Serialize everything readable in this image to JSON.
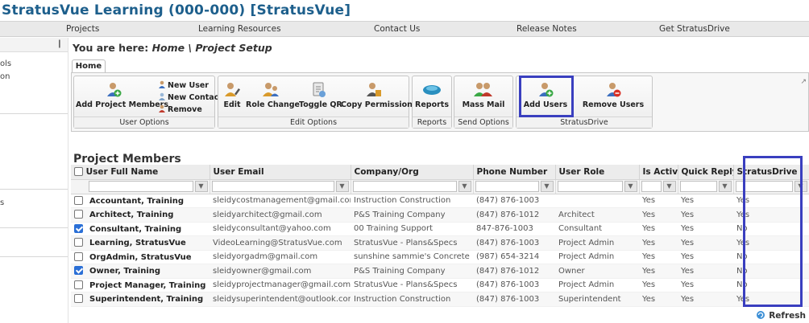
{
  "app": {
    "title": "StratusVue Learning (000-000) [StratusVue]"
  },
  "topnav": [
    "Projects",
    "Learning Resources",
    "Contact Us",
    "Release Notes",
    "Get StratusDrive"
  ],
  "leftpanel": {
    "items": [
      "ols",
      "on",
      "s"
    ]
  },
  "breadcrumb": {
    "prefix": "You are here:",
    "path": "Home \\ Project Setup"
  },
  "ribbon": {
    "tab": "Home",
    "user_options": {
      "add_project_members": "Add Project Members",
      "new_user": "New User",
      "new_contact": "New Contact",
      "remove": "Remove",
      "label": "User Options"
    },
    "edit_options": {
      "edit": "Edit",
      "role_change": "Role Change",
      "toggle_qr": "Toggle QR",
      "copy_permissions": "Copy Permissions",
      "label": "Edit Options"
    },
    "reports": {
      "reports": "Reports",
      "label": "Reports"
    },
    "send_options": {
      "mass_mail": "Mass Mail",
      "label": "Send Options"
    },
    "stratusdrive": {
      "add_users": "Add Users",
      "remove_users": "Remove Users",
      "label": "StratusDrive"
    }
  },
  "members": {
    "title": "Project Members",
    "columns": [
      "User Full Name",
      "User Email",
      "Company/Org",
      "Phone Number",
      "User Role",
      "Is Active",
      "Quick Reply",
      "StratusDrive"
    ],
    "rows": [
      {
        "checked": false,
        "name": "Accountant, Training",
        "email": "sleidycostmanagement@gmail.com",
        "company": "Instruction Construction",
        "phone": "(847) 876-1003",
        "role": "",
        "active": "Yes",
        "quick_reply": "Yes",
        "stratusdrive": "Yes"
      },
      {
        "checked": false,
        "name": "Architect, Training",
        "email": "sleidyarchitect@gmail.com",
        "company": "P&S Training Company",
        "phone": "(847) 876-1012",
        "role": "Architect",
        "active": "Yes",
        "quick_reply": "Yes",
        "stratusdrive": "Yes"
      },
      {
        "checked": true,
        "name": "Consultant, Training",
        "email": "sleidyconsultant@yahoo.com",
        "company": "00 Training Support",
        "phone": "847-876-1003",
        "role": "Consultant",
        "active": "Yes",
        "quick_reply": "Yes",
        "stratusdrive": "No"
      },
      {
        "checked": false,
        "name": "Learning, StratusVue",
        "email": "VideoLearning@StratusVue.com",
        "company": "StratusVue - Plans&Specs",
        "phone": "(847) 876-1003",
        "role": "Project Admin",
        "active": "Yes",
        "quick_reply": "Yes",
        "stratusdrive": "Yes"
      },
      {
        "checked": false,
        "name": "OrgAdmin, StratusVue",
        "email": "sleidyorgadm@gmail.com",
        "company": "sunshine sammie's Concrete",
        "phone": "(987) 654-3214",
        "role": "Project Admin",
        "active": "Yes",
        "quick_reply": "Yes",
        "stratusdrive": "No"
      },
      {
        "checked": true,
        "name": "Owner, Training",
        "email": "sleidyowner@gmail.com",
        "company": "P&S Training Company",
        "phone": "(847) 876-1012",
        "role": "Owner",
        "active": "Yes",
        "quick_reply": "Yes",
        "stratusdrive": "No"
      },
      {
        "checked": false,
        "name": "Project Manager, Training",
        "email": "sleidyprojectmanager@gmail.com",
        "company": "StratusVue - Plans&Specs",
        "phone": "(847) 876-1003",
        "role": "Project Admin",
        "active": "Yes",
        "quick_reply": "Yes",
        "stratusdrive": "No"
      },
      {
        "checked": false,
        "name": "Superintendent, Training",
        "email": "sleidysuperintendent@outlook.com",
        "company": "Instruction Construction",
        "phone": "(847) 876-1003",
        "role": "Superintendent",
        "active": "Yes",
        "quick_reply": "Yes",
        "stratusdrive": "Yes"
      }
    ]
  },
  "refresh": "Refresh",
  "colors": {
    "title": "#1d5f8c",
    "highlight": "#3a3fbf",
    "checkbox": "#2a6fd6"
  }
}
